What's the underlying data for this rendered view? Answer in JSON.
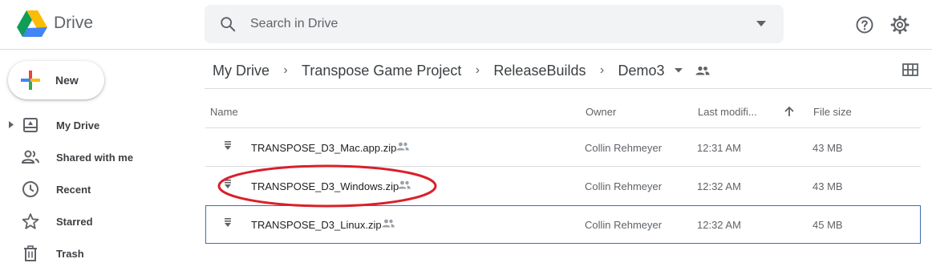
{
  "app": {
    "name": "Drive"
  },
  "search": {
    "placeholder": "Search in Drive",
    "value": ""
  },
  "sidebar": {
    "new_label": "New",
    "items": [
      {
        "label": "My Drive",
        "icon": "my-drive-icon"
      },
      {
        "label": "Shared with me",
        "icon": "people-icon"
      },
      {
        "label": "Recent",
        "icon": "clock-icon"
      },
      {
        "label": "Starred",
        "icon": "star-icon"
      },
      {
        "label": "Trash",
        "icon": "trash-icon"
      }
    ]
  },
  "breadcrumb": [
    "My Drive",
    "Transpose Game Project",
    "ReleaseBuilds",
    "Demo3"
  ],
  "columns": {
    "name": "Name",
    "owner": "Owner",
    "modified": "Last modifi...",
    "size": "File size"
  },
  "files": [
    {
      "name": "TRANSPOSE_D3_Mac.app.zip",
      "owner": "Collin Rehmeyer",
      "modified": "12:31 AM",
      "size": "43 MB",
      "shared": true
    },
    {
      "name": "TRANSPOSE_D3_Windows.zip",
      "owner": "Collin Rehmeyer",
      "modified": "12:32 AM",
      "size": "43 MB",
      "shared": true
    },
    {
      "name": "TRANSPOSE_D3_Linux.zip",
      "owner": "Collin Rehmeyer",
      "modified": "12:32 AM",
      "size": "45 MB",
      "shared": true
    }
  ],
  "colors": {
    "annotation": "#d9202a",
    "selection_border": "#3b6fb6",
    "divider": "#dadce0"
  }
}
